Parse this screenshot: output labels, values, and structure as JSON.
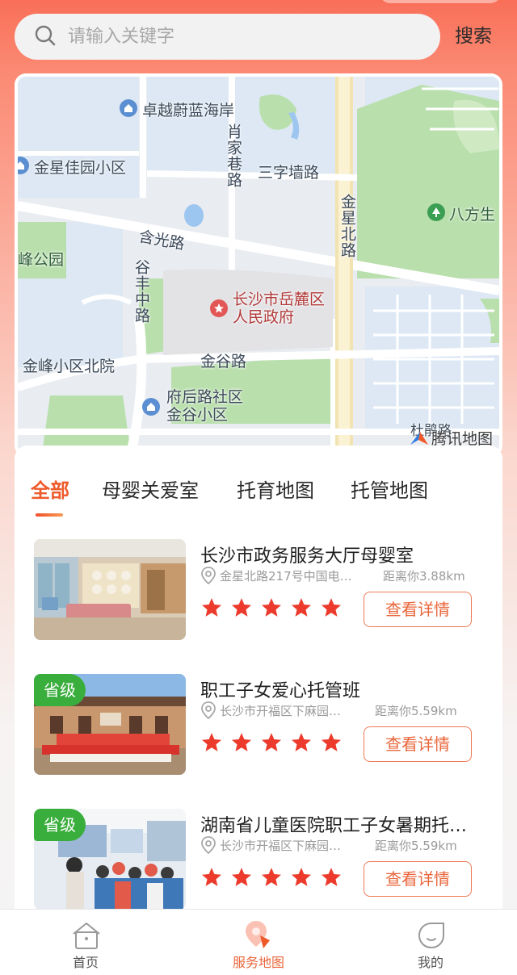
{
  "search": {
    "placeholder": "请输入关键字",
    "button_label": "搜索"
  },
  "map": {
    "labels": {
      "zhuoyue": "卓越蔚蓝海岸",
      "jinxing_garden": "金星佳园小区",
      "xiaojia_lane": "肖家巷路",
      "sanziqiang_road": "三字墙路",
      "jinxing_north_road": "金星北路",
      "bafang": "八方生",
      "hanguang_road": "含光路",
      "feng_park": "峰公园",
      "gufeng_middle_road": "谷丰中路",
      "government": "长沙市岳麓区\n人民政府",
      "jinfeng_north_yard": "金峰小区北院",
      "jingu_road": "金谷路",
      "fuhou_community": "府后路社区\n金谷小区",
      "bottom_road": "杜鹃路",
      "map_provider": "腾讯地图"
    }
  },
  "tabs": [
    {
      "label": "全部",
      "active": true
    },
    {
      "label": "母婴关爱室",
      "active": false
    },
    {
      "label": "托育地图",
      "active": false
    },
    {
      "label": "托管地图",
      "active": false
    }
  ],
  "cards": [
    {
      "title": "长沙市政务服务大厅母婴室",
      "address": "金星北路217号中国电…",
      "distance": "距离你3.88km",
      "rating": 5,
      "badge": "",
      "button_label": "查看详情"
    },
    {
      "title": "职工子女爱心托管班",
      "address": "长沙市开福区下麻园…",
      "distance": "距离你5.59km",
      "rating": 5,
      "badge": "省级",
      "button_label": "查看详情"
    },
    {
      "title": "湖南省儿童医院职工子女暑期托…",
      "address": "长沙市开福区下麻园…",
      "distance": "距离你5.59km",
      "rating": 5,
      "badge": "省级",
      "button_label": "查看详情"
    }
  ],
  "bottom_nav": [
    {
      "label": "首页",
      "icon": "home-icon",
      "active": false
    },
    {
      "label": "服务地图",
      "icon": "map-pin-icon",
      "active": true
    },
    {
      "label": "我的",
      "icon": "profile-icon",
      "active": false
    }
  ],
  "colors": {
    "accent": "#ee5a2a",
    "badge_green": "#3aae3c",
    "star_red": "#ec3b2c"
  }
}
